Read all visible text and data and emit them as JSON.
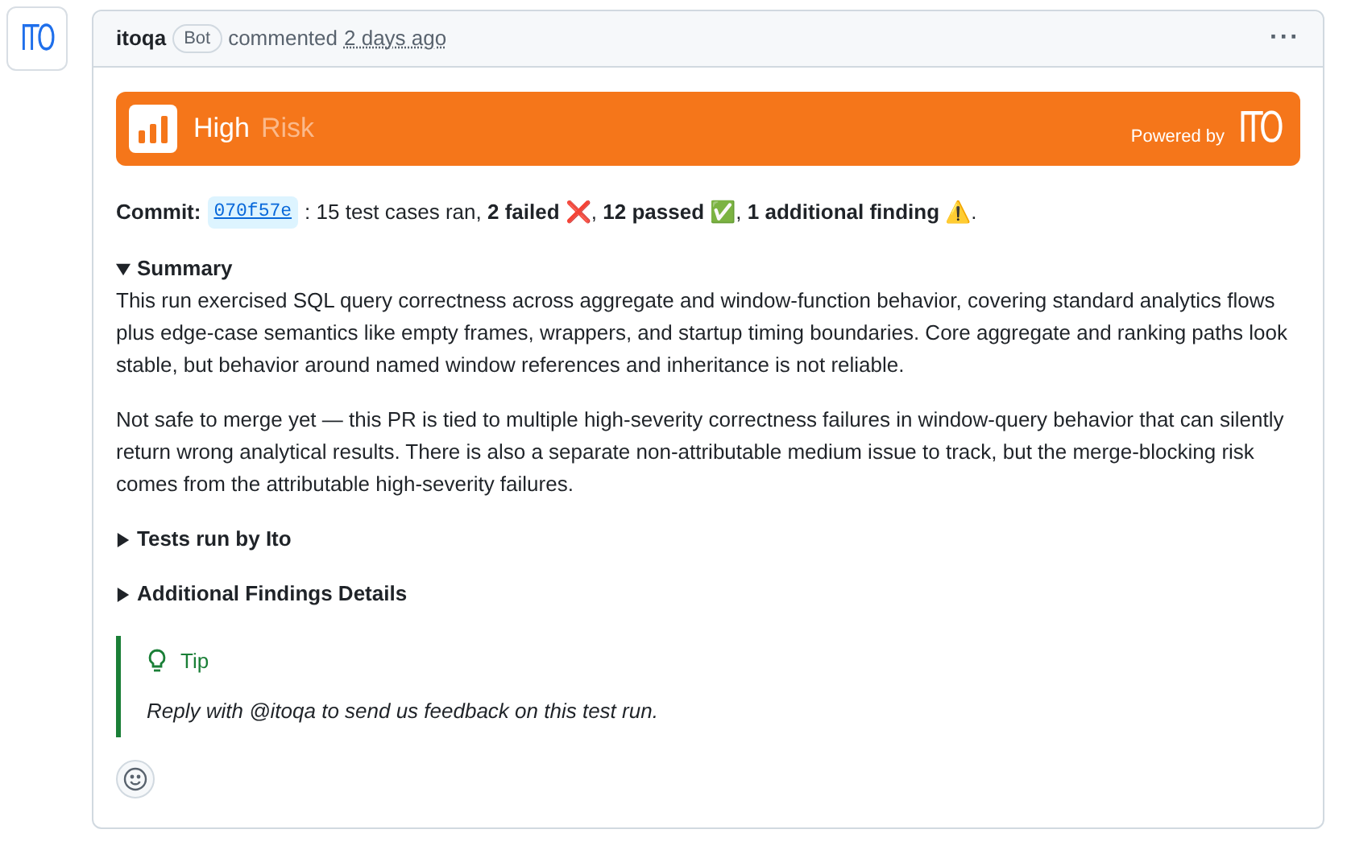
{
  "avatar": {
    "logo": "ITO"
  },
  "header": {
    "author": "itoqa",
    "badge": "Bot",
    "action": "commented",
    "time": "2 days ago",
    "menu": "···"
  },
  "banner": {
    "level": "High",
    "label": "Risk",
    "powered_by": "Powered by",
    "logo": "ITO"
  },
  "commit": {
    "label": "Commit:",
    "hash": "070f57e",
    "text": " : 15 test cases ran, **2 failed ❌**, **12 passed ✅**, **1 additional finding ⚠️**."
  },
  "sections": [
    {
      "title": "Summary",
      "expanded": true,
      "paragraphs": [
        "This run exercised SQL query correctness across aggregate and window-function behavior, covering standard analytics flows plus edge-case semantics like empty frames, wrappers, and startup timing boundaries. Core aggregate and ranking paths look stable, but behavior around named window references and inheritance is not reliable.",
        "Not safe to merge yet — this PR is tied to multiple high-severity correctness failures in window-query behavior that can silently return wrong analytical results. There is also a separate non-attributable medium issue to track, but the merge-blocking risk comes from the attributable high-severity failures."
      ]
    },
    {
      "title": "Tests run by Ito",
      "expanded": false
    },
    {
      "title": "Additional Findings Details",
      "expanded": false
    }
  ],
  "tip": {
    "title": "Tip",
    "text": "Reply with @itoqa to send us feedback on this test run."
  }
}
